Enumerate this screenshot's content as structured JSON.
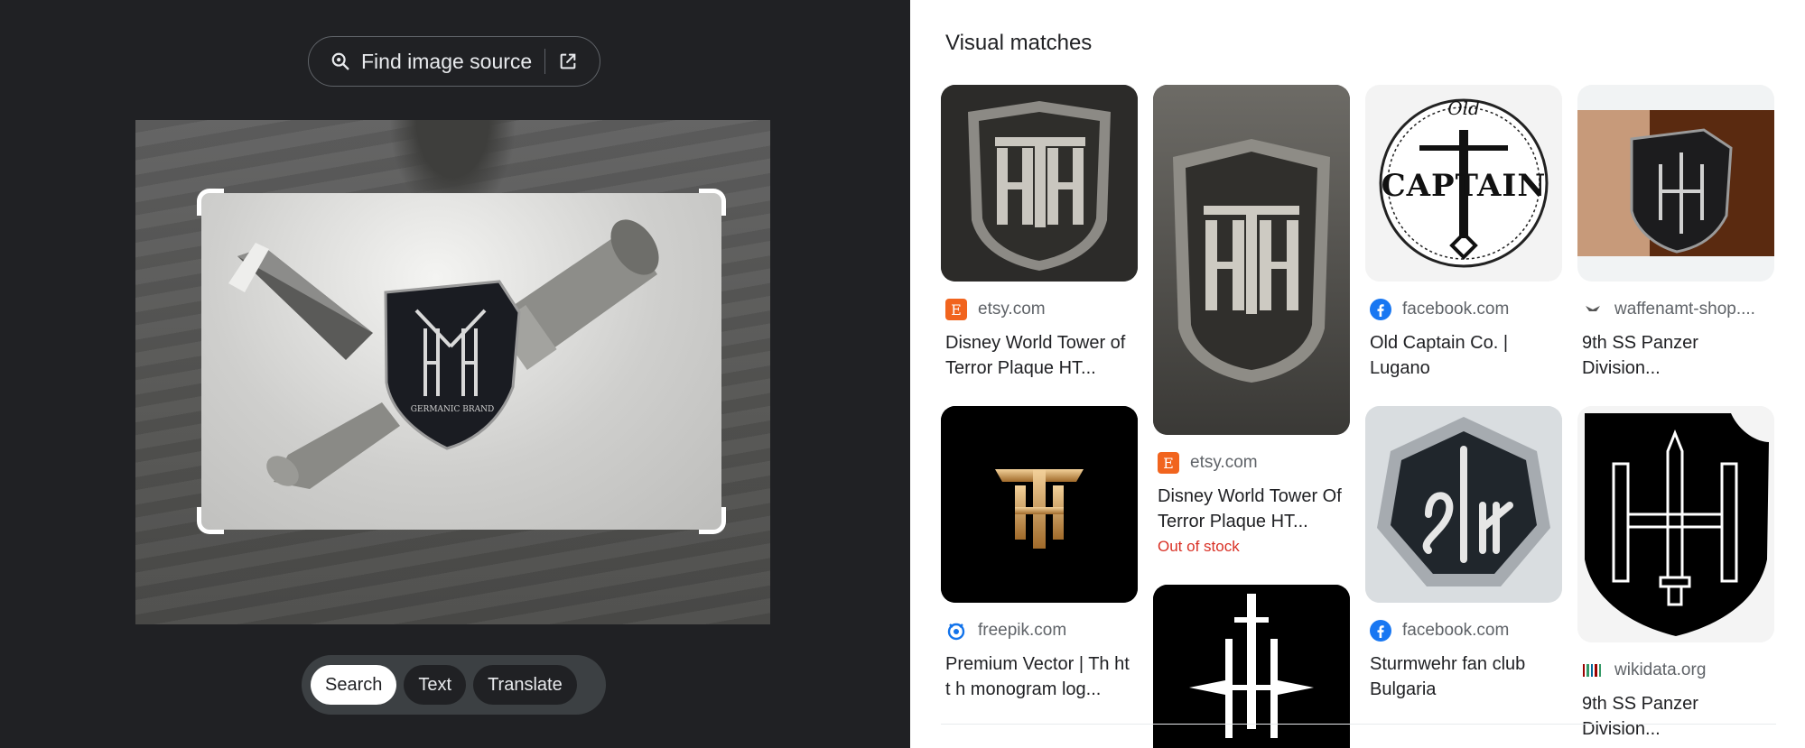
{
  "find_source": {
    "label": "Find image source",
    "icon": "lens-search-icon",
    "ext_icon": "open-in-new-icon"
  },
  "modes": [
    {
      "label": "Search",
      "active": true
    },
    {
      "label": "Text",
      "active": false
    },
    {
      "label": "Translate",
      "active": false
    }
  ],
  "preview": {
    "emblem_text": "GERMANIC BRAND"
  },
  "visual_matches": {
    "title": "Visual matches",
    "cards": [
      {
        "source": "etsy.com",
        "favicon": "etsy-icon",
        "title": "Disney World Tower of Terror Plaque HT..."
      },
      {
        "source": "etsy.com",
        "favicon": "etsy-icon",
        "title": "Disney World Tower Of Terror Plaque HT...",
        "status": "Out of stock"
      },
      {
        "source": "facebook.com",
        "favicon": "facebook-icon",
        "title": "Old Captain Co. | Lugano",
        "thumb_text": {
          "top": "Old",
          "main": "CAPTAIN"
        }
      },
      {
        "source": "waffenamt-shop....",
        "favicon": "waffenamt-icon",
        "title": "9th SS Panzer Division..."
      },
      {
        "source": "freepik.com",
        "favicon": "freepik-icon",
        "title": "Premium Vector | Th ht t h monogram log..."
      },
      {
        "source": "facebook.com",
        "favicon": "facebook-icon",
        "title": "Sturmwehr fan club Bulgaria"
      },
      {
        "source": "wikidata.org",
        "favicon": "wikidata-icon",
        "title": "9th SS Panzer Division..."
      },
      {
        "source": "",
        "favicon": "",
        "title": ""
      }
    ]
  },
  "colors": {
    "dark_bg": "#202124",
    "error": "#d93025",
    "facebook": "#1877f2",
    "etsy": "#f1641e"
  }
}
